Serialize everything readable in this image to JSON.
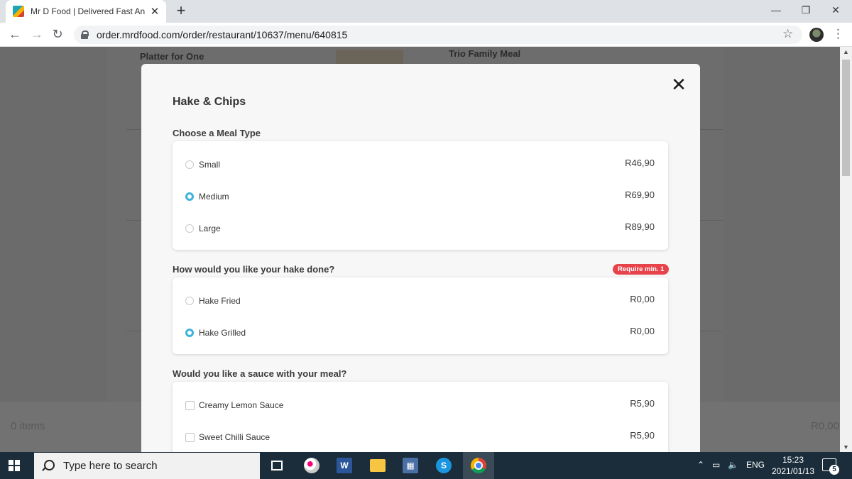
{
  "browser": {
    "tab_title": "Mr D Food | Delivered Fast And H",
    "tab_close": "✕",
    "new_tab": "+",
    "url": "order.mrdfood.com/order/restaurant/10637/menu/640815",
    "window_controls": {
      "minimize": "—",
      "restore": "❐",
      "close": "✕"
    }
  },
  "background_page": {
    "heading_left": "Platter for One",
    "heading_right": "Trio Family Meal",
    "cart_count": "0 items",
    "cart_total": "R0,00"
  },
  "modal": {
    "close_glyph": "✕",
    "title": "Hake & Chips",
    "sections": [
      {
        "title": "Choose a Meal Type",
        "control": "radio",
        "options": [
          {
            "label": "Small",
            "price": "R46,90",
            "selected": false
          },
          {
            "label": "Medium",
            "price": "R69,90",
            "selected": true
          },
          {
            "label": "Large",
            "price": "R89,90",
            "selected": false
          }
        ]
      },
      {
        "title": "How would you like your hake done?",
        "badge": "Require min. 1",
        "control": "radio",
        "options": [
          {
            "label": "Hake Fried",
            "price": "R0,00",
            "selected": false
          },
          {
            "label": "Hake Grilled",
            "price": "R0,00",
            "selected": true
          }
        ]
      },
      {
        "title": "Would you like a sauce with your meal?",
        "control": "checkbox",
        "options": [
          {
            "label": "Creamy Lemon Sauce",
            "price": "R5,90",
            "selected": false
          },
          {
            "label": "Sweet Chilli Sauce",
            "price": "R5,90",
            "selected": false
          }
        ]
      }
    ],
    "colors": {
      "accent": "#3fb2de",
      "badge": "#e8434b"
    }
  },
  "taskbar": {
    "search_placeholder": "Type here to search",
    "apps": [
      "task-view-icon",
      "paint-3d-icon",
      "word-icon",
      "file-explorer-icon",
      "calculator-icon",
      "skype-icon",
      "chrome-icon"
    ],
    "language": "ENG",
    "time": "15:23",
    "date": "2021/01/13",
    "notification_count": "5"
  }
}
